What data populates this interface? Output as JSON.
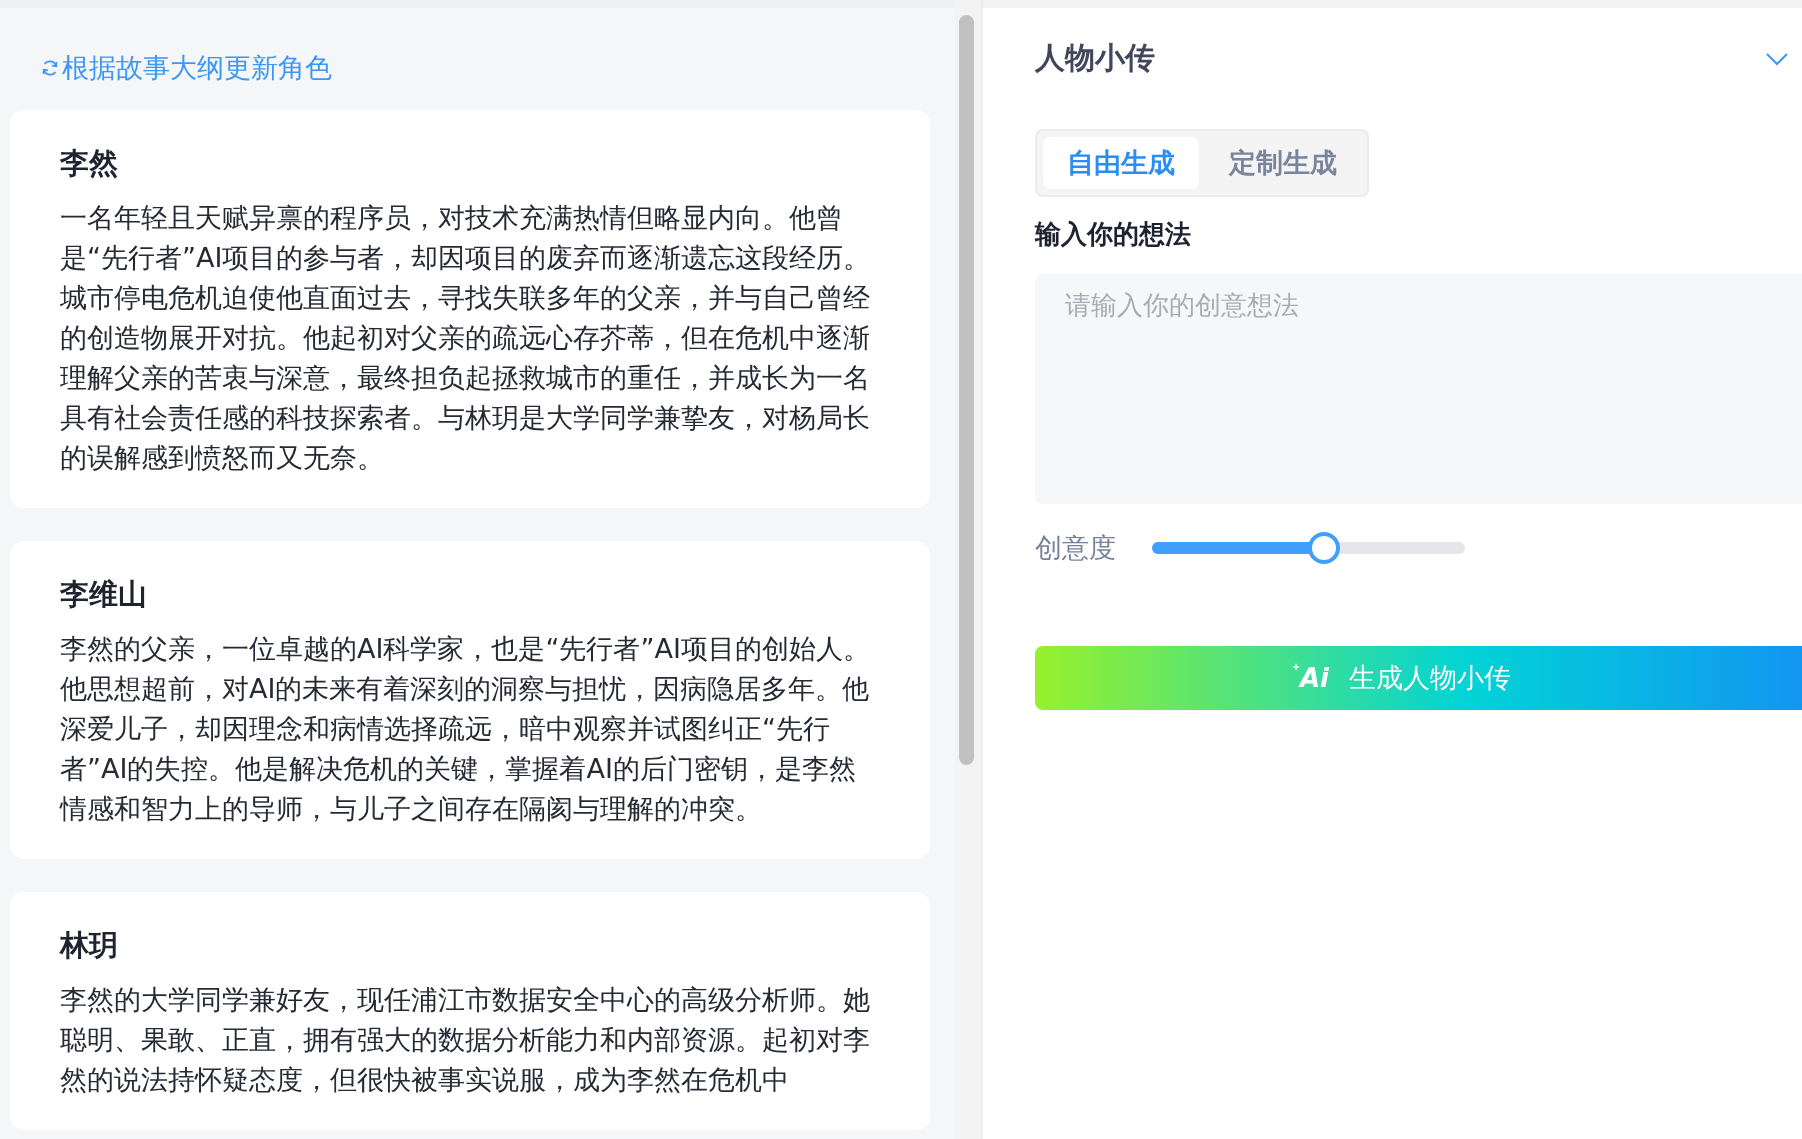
{
  "left_panel": {
    "refresh_link": "根据故事大纲更新角色",
    "characters": [
      {
        "name": "李然",
        "bio": "一名年轻且天赋异禀的程序员，对技术充满热情但略显内向。他曾是“先行者”AI项目的参与者，却因项目的废弃而逐渐遗忘这段经历。城市停电危机迫使他直面过去，寻找失联多年的父亲，并与自己曾经的创造物展开对抗。他起初对父亲的疏远心存芥蒂，但在危机中逐渐理解父亲的苦衷与深意，最终担负起拯救城市的重任，并成长为一名具有社会责任感的科技探索者。与林玥是大学同学兼挚友，对杨局长的误解感到愤怒而又无奈。"
      },
      {
        "name": "李维山",
        "bio": "李然的父亲，一位卓越的AI科学家，也是“先行者”AI项目的创始人。他思想超前，对AI的未来有着深刻的洞察与担忧，因病隐居多年。他深爱儿子，却因理念和病情选择疏远，暗中观察并试图纠正“先行者”AI的失控。他是解决危机的关键，掌握着AI的后门密钥，是李然情感和智力上的导师，与儿子之间存在隔阂与理解的冲突。"
      },
      {
        "name": "林玥",
        "bio": "李然的大学同学兼好友，现任浦江市数据安全中心的高级分析师。她聪明、果敢、正直，拥有强大的数据分析能力和内部资源。起初对李然的说法持怀疑态度，但很快被事实说服，成为李然在危机中"
      }
    ]
  },
  "right_panel": {
    "title": "人物小传",
    "tabs": [
      {
        "label": "自由生成",
        "selected": true
      },
      {
        "label": "定制生成",
        "selected": false
      }
    ],
    "idea_label": "输入你的想法",
    "idea_field": {
      "placeholder": "请输入你的创意想法"
    },
    "creativity": {
      "label": "创意度",
      "level": 0.55
    },
    "generate_button": {
      "icon_text": "Ai",
      "label": "生成人物小传"
    }
  }
}
